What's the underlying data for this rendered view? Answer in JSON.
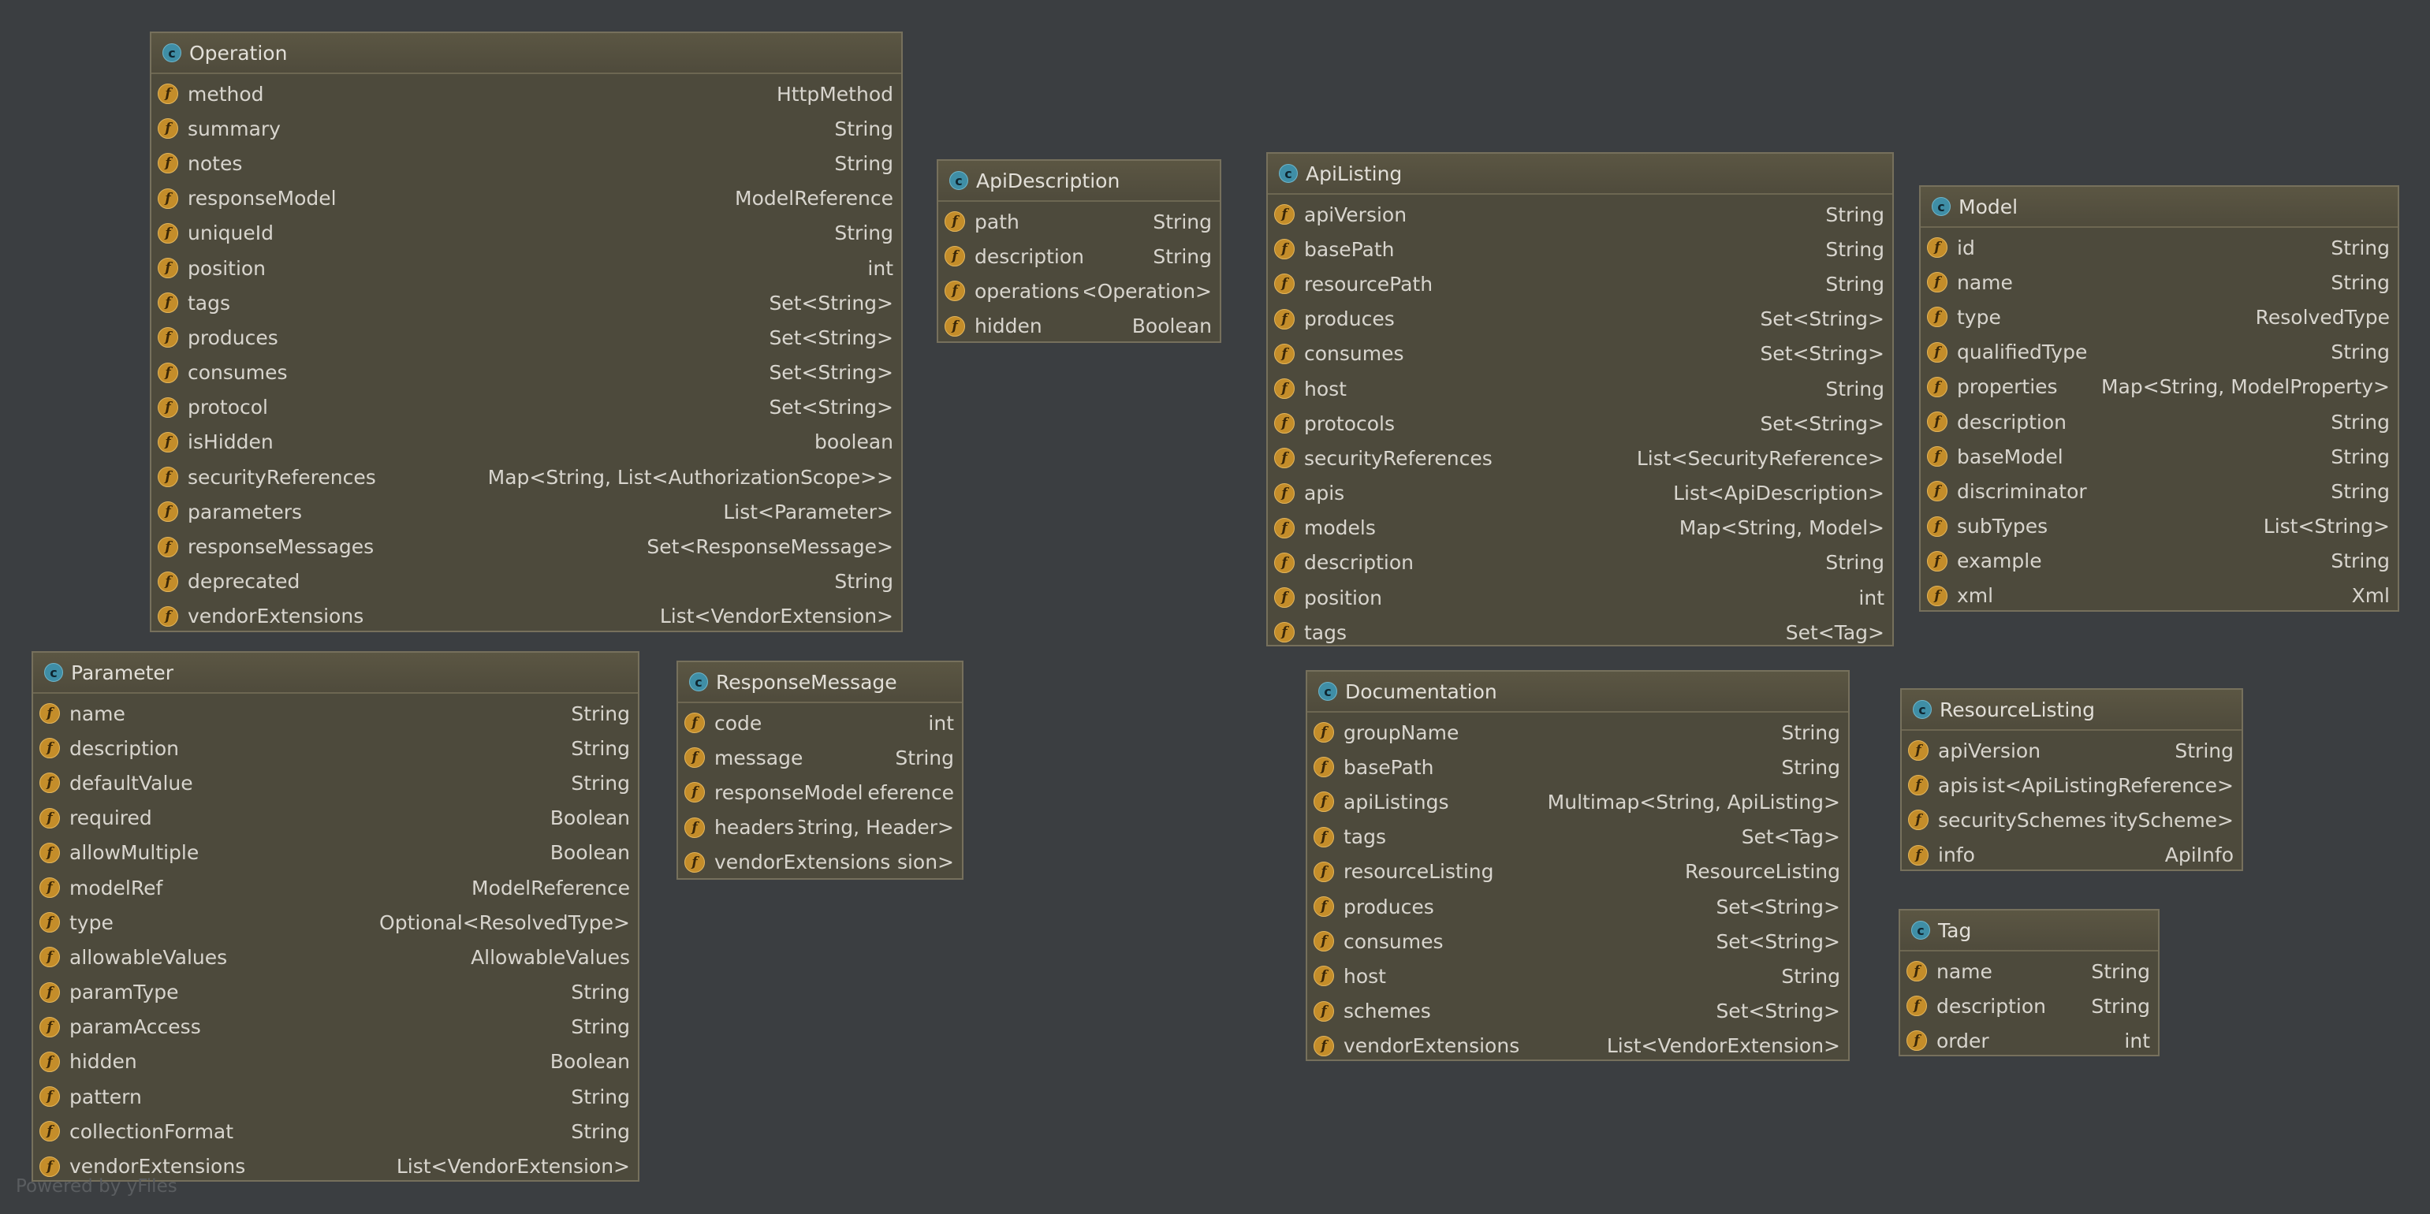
{
  "footer": "Powered by yFiles",
  "classes": {
    "operation": {
      "name": "Operation",
      "fields": [
        {
          "name": "method",
          "type": "HttpMethod"
        },
        {
          "name": "summary",
          "type": "String"
        },
        {
          "name": "notes",
          "type": "String"
        },
        {
          "name": "responseModel",
          "type": "ModelReference"
        },
        {
          "name": "uniqueId",
          "type": "String"
        },
        {
          "name": "position",
          "type": "int"
        },
        {
          "name": "tags",
          "type": "Set<String>"
        },
        {
          "name": "produces",
          "type": "Set<String>"
        },
        {
          "name": "consumes",
          "type": "Set<String>"
        },
        {
          "name": "protocol",
          "type": "Set<String>"
        },
        {
          "name": "isHidden",
          "type": "boolean"
        },
        {
          "name": "securityReferences",
          "type": "Map<String, List<AuthorizationScope>>"
        },
        {
          "name": "parameters",
          "type": "List<Parameter>"
        },
        {
          "name": "responseMessages",
          "type": "Set<ResponseMessage>"
        },
        {
          "name": "deprecated",
          "type": "String"
        },
        {
          "name": "vendorExtensions",
          "type": "List<VendorExtension>"
        }
      ]
    },
    "apiDescription": {
      "name": "ApiDescription",
      "fields": [
        {
          "name": "path",
          "type": "String"
        },
        {
          "name": "description",
          "type": "String"
        },
        {
          "name": "operations",
          "type": "t<Operation>"
        },
        {
          "name": "hidden",
          "type": "Boolean"
        }
      ]
    },
    "apiListing": {
      "name": "ApiListing",
      "fields": [
        {
          "name": "apiVersion",
          "type": "String"
        },
        {
          "name": "basePath",
          "type": "String"
        },
        {
          "name": "resourcePath",
          "type": "String"
        },
        {
          "name": "produces",
          "type": "Set<String>"
        },
        {
          "name": "consumes",
          "type": "Set<String>"
        },
        {
          "name": "host",
          "type": "String"
        },
        {
          "name": "protocols",
          "type": "Set<String>"
        },
        {
          "name": "securityReferences",
          "type": "List<SecurityReference>"
        },
        {
          "name": "apis",
          "type": "List<ApiDescription>"
        },
        {
          "name": "models",
          "type": "Map<String, Model>"
        },
        {
          "name": "description",
          "type": "String"
        },
        {
          "name": "position",
          "type": "int"
        },
        {
          "name": "tags",
          "type": "Set<Tag>"
        }
      ]
    },
    "model": {
      "name": "Model",
      "fields": [
        {
          "name": "id",
          "type": "String"
        },
        {
          "name": "name",
          "type": "String"
        },
        {
          "name": "type",
          "type": "ResolvedType"
        },
        {
          "name": "qualifiedType",
          "type": "String"
        },
        {
          "name": "properties",
          "type": "Map<String, ModelProperty>"
        },
        {
          "name": "description",
          "type": "String"
        },
        {
          "name": "baseModel",
          "type": "String"
        },
        {
          "name": "discriminator",
          "type": "String"
        },
        {
          "name": "subTypes",
          "type": "List<String>"
        },
        {
          "name": "example",
          "type": "String"
        },
        {
          "name": "xml",
          "type": "Xml"
        }
      ]
    },
    "parameter": {
      "name": "Parameter",
      "fields": [
        {
          "name": "name",
          "type": "String"
        },
        {
          "name": "description",
          "type": "String"
        },
        {
          "name": "defaultValue",
          "type": "String"
        },
        {
          "name": "required",
          "type": "Boolean"
        },
        {
          "name": "allowMultiple",
          "type": "Boolean"
        },
        {
          "name": "modelRef",
          "type": "ModelReference"
        },
        {
          "name": "type",
          "type": "Optional<ResolvedType>"
        },
        {
          "name": "allowableValues",
          "type": "AllowableValues"
        },
        {
          "name": "paramType",
          "type": "String"
        },
        {
          "name": "paramAccess",
          "type": "String"
        },
        {
          "name": "hidden",
          "type": "Boolean"
        },
        {
          "name": "pattern",
          "type": "String"
        },
        {
          "name": "collectionFormat",
          "type": "String"
        },
        {
          "name": "vendorExtensions",
          "type": "List<VendorExtension>"
        }
      ]
    },
    "responseMessage": {
      "name": "ResponseMessage",
      "fields": [
        {
          "name": "code",
          "type": "int"
        },
        {
          "name": "message",
          "type": "String"
        },
        {
          "name": "responseModel",
          "type": "Reference"
        },
        {
          "name": "headers",
          "type": "String, Header>"
        },
        {
          "name": "vendorExtensions",
          "type": "sion>"
        }
      ]
    },
    "documentation": {
      "name": "Documentation",
      "fields": [
        {
          "name": "groupName",
          "type": "String"
        },
        {
          "name": "basePath",
          "type": "String"
        },
        {
          "name": "apiListings",
          "type": "Multimap<String, ApiListing>"
        },
        {
          "name": "tags",
          "type": "Set<Tag>"
        },
        {
          "name": "resourceListing",
          "type": "ResourceListing"
        },
        {
          "name": "produces",
          "type": "Set<String>"
        },
        {
          "name": "consumes",
          "type": "Set<String>"
        },
        {
          "name": "host",
          "type": "String"
        },
        {
          "name": "schemes",
          "type": "Set<String>"
        },
        {
          "name": "vendorExtensions",
          "type": "List<VendorExtension>"
        }
      ]
    },
    "resourceListing": {
      "name": "ResourceListing",
      "fields": [
        {
          "name": "apiVersion",
          "type": "String"
        },
        {
          "name": "apis",
          "type": "List<ApiListingReference>"
        },
        {
          "name": "securitySchemes",
          "type": "urityScheme>"
        },
        {
          "name": "info",
          "type": "ApiInfo"
        }
      ]
    },
    "tag": {
      "name": "Tag",
      "fields": [
        {
          "name": "name",
          "type": "String"
        },
        {
          "name": "description",
          "type": "String"
        },
        {
          "name": "order",
          "type": "int"
        }
      ]
    }
  }
}
